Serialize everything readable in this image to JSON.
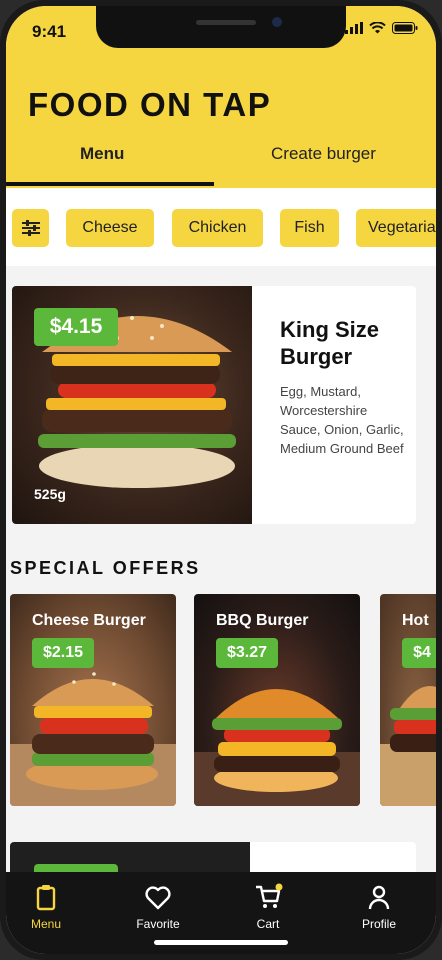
{
  "status_bar": {
    "time": "9:41",
    "icons": [
      "signal-icon",
      "wifi-icon",
      "battery-icon"
    ]
  },
  "header": {
    "title": "FOOD ON TAP",
    "tabs": [
      {
        "label": "Menu",
        "active": true
      },
      {
        "label": "Create burger",
        "active": false
      }
    ]
  },
  "filters": {
    "filter_icon": "sliders-icon",
    "chips": [
      "Cheese",
      "Chicken",
      "Fish",
      "Vegetaria"
    ]
  },
  "featured": {
    "price": "$4.15",
    "weight": "525g",
    "name": "King Size Burger",
    "description": "Egg, Mustard, Worcestershire Sauce, Onion, Garlic, Medium Ground Beef"
  },
  "special_offers": {
    "title": "SPECIAL OFFERS",
    "items": [
      {
        "name": "Cheese Burger",
        "price": "$2.15"
      },
      {
        "name": "BBQ Burger",
        "price": "$3.27"
      },
      {
        "name": "Hot",
        "price": "$4"
      }
    ]
  },
  "bottom_nav": {
    "items": [
      {
        "label": "Menu",
        "icon": "clipboard-icon",
        "active": true
      },
      {
        "label": "Favorite",
        "icon": "heart-icon",
        "active": false
      },
      {
        "label": "Cart",
        "icon": "cart-icon",
        "active": false
      },
      {
        "label": "Profile",
        "icon": "user-icon",
        "active": false
      }
    ]
  },
  "colors": {
    "accent": "#f5d640",
    "price": "#5cb83a",
    "nav_bg": "#141414"
  }
}
